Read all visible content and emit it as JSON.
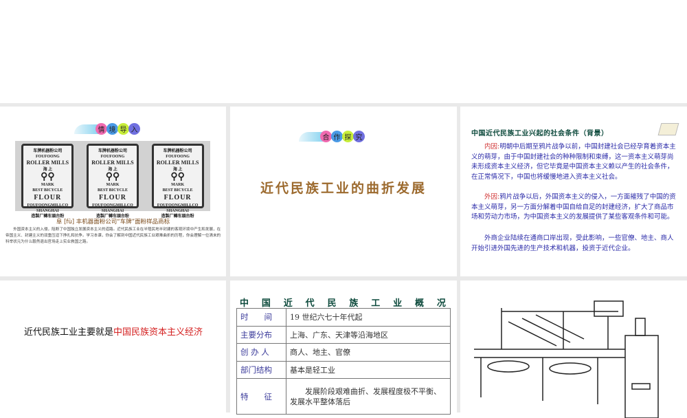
{
  "slide1": {
    "badge": [
      "情",
      "境",
      "导",
      "入"
    ],
    "bag_text": {
      "top": "车牌机器粉公司",
      "brand": "FOUFOONG",
      "mills": "ROLLER MILLS",
      "city_cn": "海 上",
      "mark": "MARK",
      "best": "BEST BICYCLE",
      "flour": "FLOUR",
      "company": "FOUFOONGMILLCO",
      "shanghai": "SHANGHAI",
      "bottom": "造製厂轉车頭台粉"
    },
    "caption": "阜 [fù] 丰机器面粉公司“车牌”面粉样品商标",
    "intro": "外国资本主义的入侵，阻断了中国独立发展资本主义的道路。近代民族工业在半殖民地半封建的客观环境中产生和发展，在帝国主义、封建主义的双重压迫下挣扎和抗争。学习本课，你会了解到中国近代民族工业艰难曲折的历程，你会理解一位清末的科举状元为什么毅然退出官场走上实业救国之路。"
  },
  "slide2": {
    "badge": [
      "合",
      "作",
      "探",
      "究"
    ],
    "title": "近代民族工业的曲折发展"
  },
  "slide3": {
    "title": "中国近代民族工业兴起的社会条件（背景）",
    "p1_label": "内因:",
    "p1": "明朝中后期至鸦片战争以前，中国封建社会已经孕育着资本主义的萌芽，由于中国封建社会的种种限制和束缚，这一资本主义萌芽尚未形成资本主义经济，但它毕竟是中国资本主义赖以产生的社会条件，在正常情况下，中国也将缓慢地进入资本主义社会。",
    "p2_label": "外因:",
    "p2": "鸦片战争以后，外国资本主义的侵入，一方面摧残了中国的资本主义萌芽，另一方面分解着中国自给自足的封建经济，扩大了商品市场和劳动力市场，为中国资本主义的发展提供了某些客观条件和可能。",
    "p3": "外商企业陆续在通商口岸出现，受此影响，一些官僚、地主、商人开始引进外国先进的生产技术和机器，投资于近代企业。"
  },
  "slide4": {
    "text_plain": "近代民族工业主要就是",
    "text_red": "中国民族资本主义经济"
  },
  "slide5": {
    "title": [
      "中",
      "国",
      "近",
      "代",
      "民",
      "族",
      "工",
      "业",
      "概",
      "况"
    ],
    "rows": [
      {
        "k": "时　　间",
        "v": "19 世纪六七十年代起"
      },
      {
        "k": "主要分布",
        "v": "上海、广东、天津等沿海地区"
      },
      {
        "k": "创 办 人",
        "v": "商人、地主、官僚"
      },
      {
        "k": "部门结构",
        "v": "基本是轻工业"
      },
      {
        "k": "特　　征",
        "v": "　　发展阶段艰难曲折、发展程度极不平衡、发展水平整体落后"
      }
    ]
  },
  "colors": {
    "badge": [
      "#f06ab0",
      "#4a9ae6",
      "#c8ee3a",
      "#7070e0"
    ]
  }
}
